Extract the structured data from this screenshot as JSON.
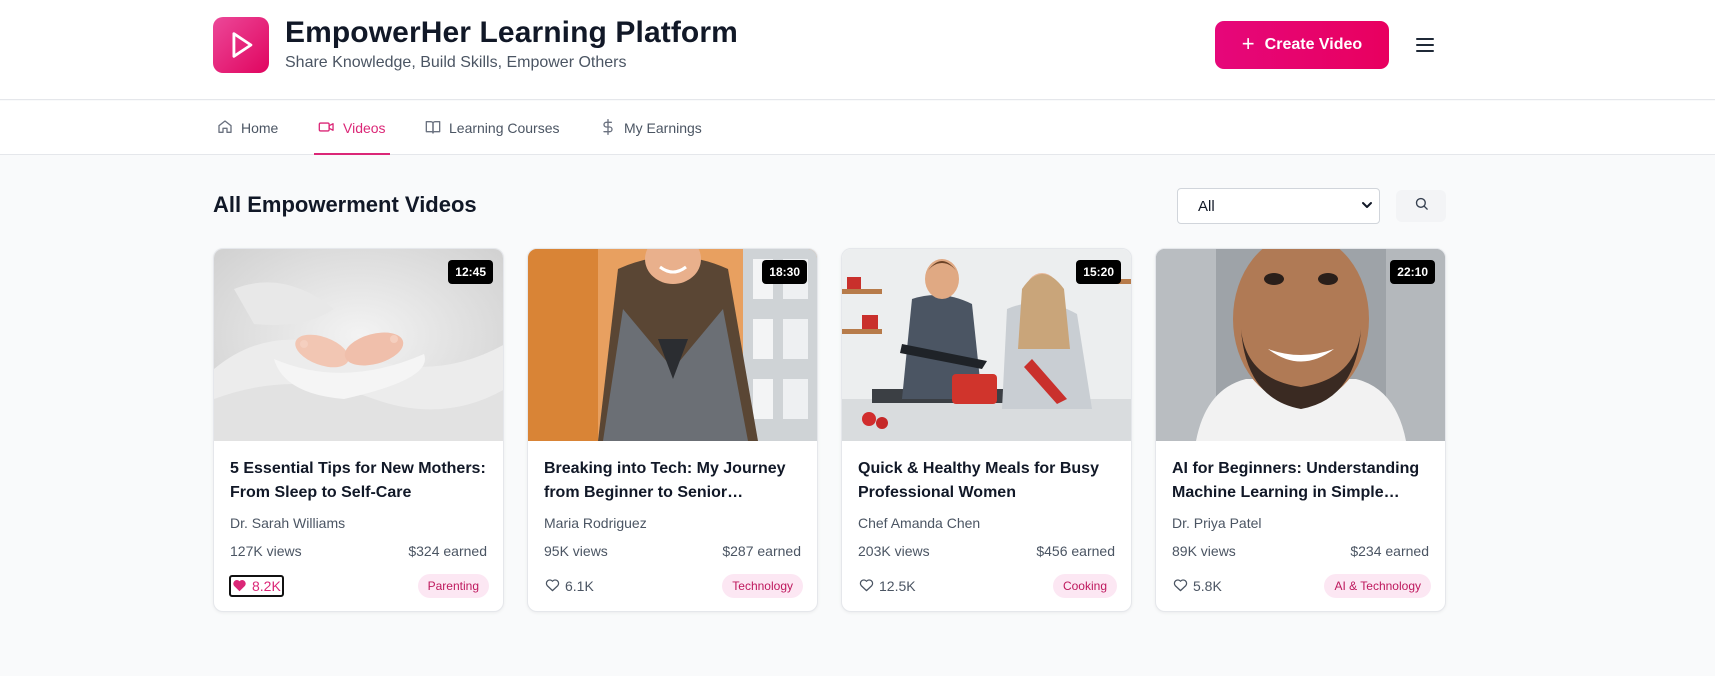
{
  "header": {
    "title": "EmpowerHer Learning Platform",
    "subtitle": "Share Knowledge, Build Skills, Empower Others",
    "create_label": "Create Video"
  },
  "nav": {
    "items": [
      {
        "label": "Home",
        "icon": "home-icon"
      },
      {
        "label": "Videos",
        "icon": "video-icon",
        "active": true
      },
      {
        "label": "Learning Courses",
        "icon": "book-icon"
      },
      {
        "label": "My Earnings",
        "icon": "dollar-icon"
      }
    ]
  },
  "main": {
    "title": "All Empowerment Videos",
    "filter_value": "All"
  },
  "colors": {
    "accent": "#db2777",
    "brand_gradient_start": "#ec4899",
    "brand_gradient_end": "#e0055f",
    "tag_bg": "#fce7f3"
  },
  "videos": [
    {
      "duration": "12:45",
      "title": "5 Essential Tips for New Mothers: From Sleep to Self-Care",
      "author": "Dr. Sarah Williams",
      "views": "127K views",
      "earned": "$324 earned",
      "likes": "8.2K",
      "liked": true,
      "tag": "Parenting"
    },
    {
      "duration": "18:30",
      "title": "Breaking into Tech: My Journey from Beginner to Senior Developer",
      "author": "Maria Rodriguez",
      "views": "95K views",
      "earned": "$287 earned",
      "likes": "6.1K",
      "liked": false,
      "tag": "Technology"
    },
    {
      "duration": "15:20",
      "title": "Quick & Healthy Meals for Busy Professional Women",
      "author": "Chef Amanda Chen",
      "views": "203K views",
      "earned": "$456 earned",
      "likes": "12.5K",
      "liked": false,
      "tag": "Cooking"
    },
    {
      "duration": "22:10",
      "title": "AI for Beginners: Understanding Machine Learning in Simple Terms",
      "author": "Dr. Priya Patel",
      "views": "89K views",
      "earned": "$234 earned",
      "likes": "5.8K",
      "liked": false,
      "tag": "AI & Technology"
    }
  ]
}
